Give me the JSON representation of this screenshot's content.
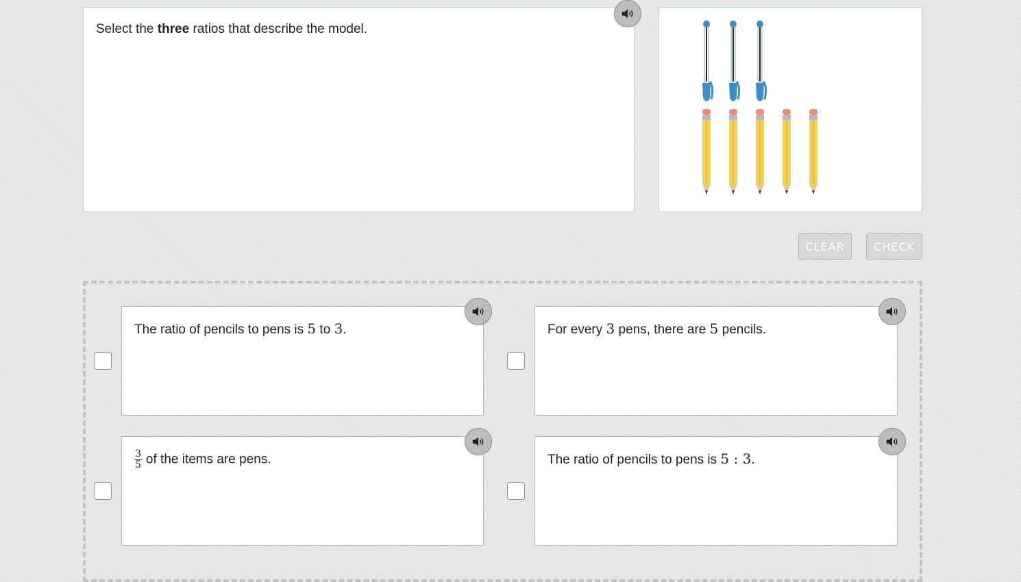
{
  "prompt": {
    "text_before": "Select the ",
    "text_bold": "three",
    "text_after": " ratios that describe the model."
  },
  "model_image": {
    "pens": 3,
    "pencils": 5,
    "pen_color": "#3d8dbf",
    "pencil_color": "#f2d15a",
    "eraser_color": "#f08a7e"
  },
  "actions": {
    "clear_label": "CLEAR",
    "check_label": "CHECK"
  },
  "choices": [
    {
      "pre": "The ratio of pencils to pens is ",
      "a": "5",
      "mid": " to ",
      "b": "3",
      "post": ".",
      "checked": false
    },
    {
      "pre": "For every ",
      "a": "3",
      "mid": " pens, there are ",
      "b": "5",
      "post": " pencils.",
      "checked": false
    },
    {
      "frac_num": "3",
      "frac_den": "5",
      "post": "of the items are pens.",
      "checked": false
    },
    {
      "pre": "The ratio of pencils to pens is ",
      "a": "5",
      "mid": " : ",
      "b": "3",
      "post": ".",
      "checked": false
    }
  ]
}
